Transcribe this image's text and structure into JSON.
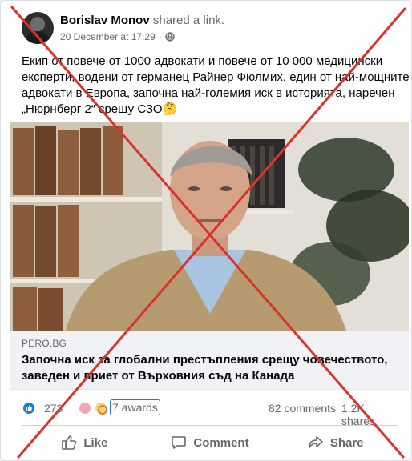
{
  "post": {
    "author": "Borislav Monov",
    "action": "shared a link.",
    "timestamp": "20 December at 17:29",
    "privacy_icon": "globe-icon",
    "text_lines": [
      "Екип от повече от 1000 адвокати и повече от 10 000 медицински",
      "експерти, водени от германец Райнер Фюлмих, един от най-мощните",
      "адвокати в Европа, започна най-големия иск в историята, наречен",
      "„Нюрнберг 2“ срещу СЗО🤔"
    ]
  },
  "link_preview": {
    "domain": "PERO.BG",
    "title": "Започна иск за глобални престъпления срещу човечеството, заведен и приет от Върховния съд на Канада"
  },
  "engagement": {
    "reaction_count": "273",
    "awards_label": "7 awards",
    "comments_label": "82 comments",
    "shares_label": "1.2K shares"
  },
  "actions": {
    "like": "Like",
    "comment": "Comment",
    "share": "Share"
  },
  "colors": {
    "facebook_blue": "#1877f2",
    "overlay_red": "#d9332b",
    "muted_text": "#65676b"
  }
}
